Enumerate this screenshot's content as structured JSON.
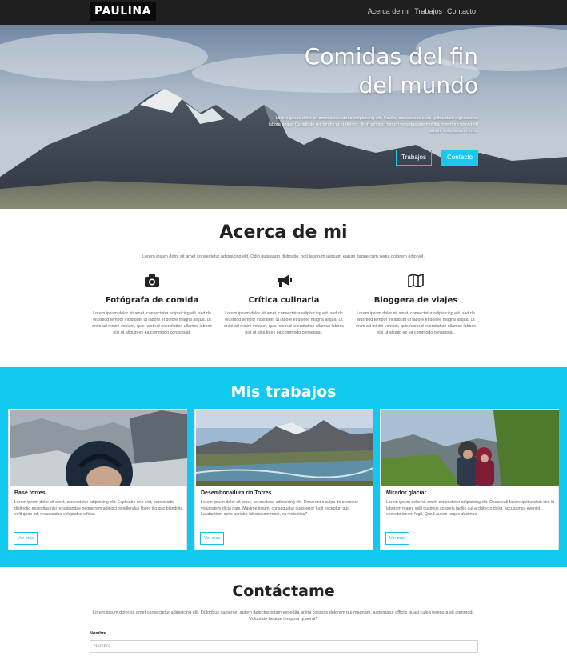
{
  "nav": {
    "brand": "PAULINA",
    "links": [
      "Acerca de mi",
      "Trabajos",
      "Contacto"
    ]
  },
  "hero": {
    "title_line1": "Comidas del fin",
    "title_line2": "del mundo",
    "text": "Lorem ipsum dolor sit amet consectetur adipisicing elit. Facilis, accusamus iusto quibusdam dignissimos labore sequi. Cupiditate reiciendis at et dolore. Illum adipisci harum voluptas iste mollitia inventore provident labore voluptatum nemo.",
    "btn_works": "Trabajos",
    "btn_contact": "Contacto"
  },
  "about": {
    "title": "Acerca de mi",
    "lead": "Lorem ipsum dolor sit amet consectetur adipisicing elit. Odio quisquam distinctio, odit laborum aliquam earum itaque cum sequi dolorem odio vol.",
    "features": [
      {
        "icon": "camera-icon",
        "title": "Fotógrafa de comida",
        "text": "Lorem ipsum dolor sit amet, consectetur adipisicing elit, sed do eiusmod tempor incididunt ut labore et dolore magna aliqua. Ut enim ad minim veniam, quis nostrud exercitation ullamco laboris nisi ut aliquip ex ea commodo consequat."
      },
      {
        "icon": "megaphone-icon",
        "title": "Crítica culinaria",
        "text": "Lorem ipsum dolor sit amet, consectetur adipisicing elit, sed do eiusmod tempor incididunt ut labore et dolore magna aliqua. Ut enim ad minim veniam, quis nostrud exercitation ullamco laboris nisi ut aliquip ex ea commodo consequat."
      },
      {
        "icon": "map-icon",
        "title": "Bloggera de viajes",
        "text": "Lorem ipsum dolor sit amet, consectetur adipisicing elit, sed do eiusmod tempor incididunt ut labore et dolore magna aliqua. Ut enim ad minim veniam, quis nostrud exercitation ullamco laboris nisi ut aliquip ex ea commodo consequat."
      }
    ]
  },
  "works": {
    "title": "Mis trabajos",
    "cards": [
      {
        "title": "Base torres",
        "text": "Lorem ipsum dolor sit amet, consectetur adipisicing elit. Explicabo une sint, perspiciatis distinctio molestias nisi repudiandae neque rem adipisci repellendus libero illo quo blanditiis, velit quae ad, recusandae voluptates officia.",
        "button": "Ver mas"
      },
      {
        "title": "Desembocadura río Torres",
        "text": "Lorem ipsum dolor sit amet, consectetur adipisicing elit. Deserunt a culpa doloremque voluptatem dicta nam. Maxime ipsum, consequatur quos error fugit excepturi quo. Laudantium optio pariatur laboriosam modi, ea molestias?",
        "button": "Ver mas"
      },
      {
        "title": "Mirador glaciar",
        "text": "Lorem ipsum dolor sit amet, consectetur adipisicing elit. Obcaecati facere quibusdam sint id laborum magni velit ducimus corporis facilis qui architecto dolor, accusamus eveniet exercitationem fugit. Quod autem neque ducimus.",
        "button": "Ver mas"
      }
    ]
  },
  "contact": {
    "title": "Contáctame",
    "lead": "Lorem ipsum dolor sit amet consectetur adipisicing elit. Doloribus sapiente, autem delectus totam expedita animi corporis dolorem qui magnam, aspernatur officiis quasi culpa tempora eit commodi. Voluptate beatae tempora quaerat?",
    "name_label": "Nombre",
    "name_placeholder": "Nombre"
  },
  "colors": {
    "accent": "#11c8ee",
    "nav_bg": "#1f1f1f"
  }
}
